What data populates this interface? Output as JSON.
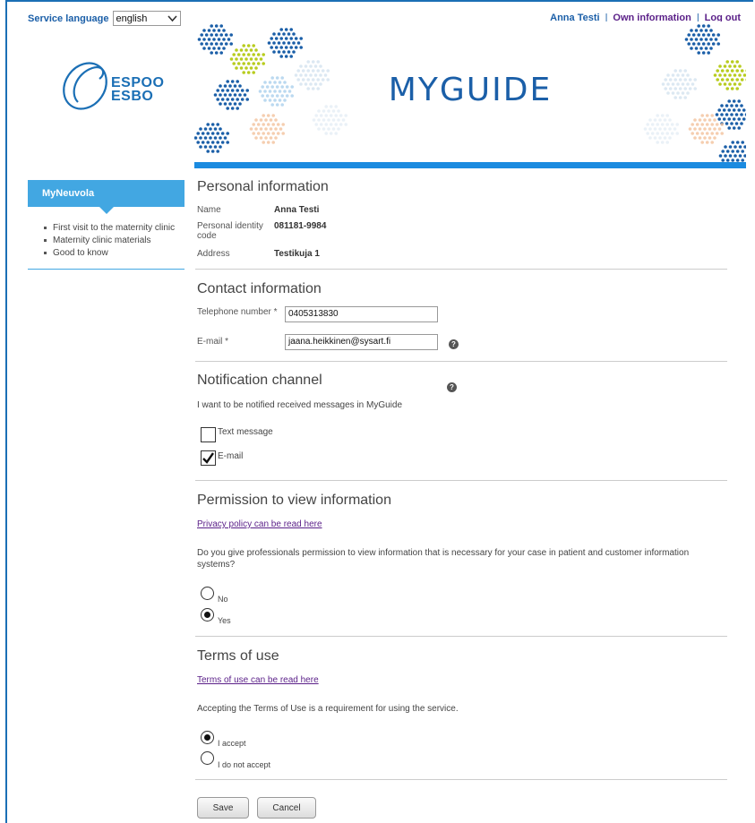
{
  "topbar": {
    "language_label": "Service language",
    "language_value": "english",
    "user_name": "Anna Testi",
    "own_info": "Own information",
    "logout": "Log out",
    "separator": "|"
  },
  "logo": {
    "line1": "ESPOO",
    "line2": "ESBO"
  },
  "banner": {
    "title_my": "MY",
    "title_guide": "GUIDE"
  },
  "sidebar": {
    "heading": "MyNeuvola",
    "items": [
      "First visit to the maternity clinic",
      "Maternity clinic materials",
      "Good to know"
    ]
  },
  "personal": {
    "title": "Personal information",
    "name_label": "Name",
    "name_value": "Anna Testi",
    "pic_label": "Personal identity code",
    "pic_value": "081181-9984",
    "address_label": "Address",
    "address_value": "Testikuja 1"
  },
  "contact": {
    "title": "Contact information",
    "phone_label": "Telephone number *",
    "phone_value": "0405313830",
    "email_label": "E-mail *",
    "email_value": "jaana.heikkinen@sysart.fi"
  },
  "notification": {
    "title": "Notification channel",
    "description": "I want to be notified received messages in MyGuide",
    "options": [
      {
        "label": "Text message",
        "checked": false
      },
      {
        "label": "E-mail",
        "checked": true
      }
    ]
  },
  "permission": {
    "title": "Permission to view information",
    "privacy_link": "Privacy policy can be read here",
    "question": "Do you give professionals permission to view information that is necessary for your case in patient and customer information systems?",
    "options": [
      {
        "label": "No",
        "selected": false
      },
      {
        "label": "Yes",
        "selected": true
      }
    ]
  },
  "terms": {
    "title": "Terms of use",
    "link": "Terms of use can be read here",
    "description": "Accepting the Terms of Use is a requirement for using the service.",
    "options": [
      {
        "label": "I accept",
        "selected": true
      },
      {
        "label": "I do not accept",
        "selected": false
      }
    ]
  },
  "actions": {
    "save": "Save",
    "cancel": "Cancel"
  },
  "colors": {
    "brand_blue": "#1b6fb5",
    "nav_blue": "#42a7e2",
    "link_purple": "#5a1f88",
    "banner_bar": "#1b8be0"
  }
}
